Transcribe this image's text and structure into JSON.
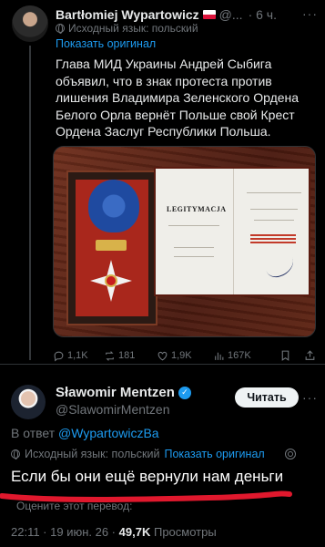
{
  "original_tweet": {
    "author_name": "Bartłomiej Wypartowicz",
    "handle": "@...",
    "time": "· 6 ч.",
    "source_language": "Исходный язык: польский",
    "show_original": "Показать оригинал",
    "text": "Глава МИД Украины Андрей Сыбига объявил, что в знак протеста против лишения Владимира Зеленского Ордена Белого Орла вернёт Польше свой Крест Ордена Заслуг Республики Польша.",
    "document_title": "LEGITYMACJA",
    "stats": {
      "replies": "1,1K",
      "reposts": "181",
      "likes": "1,9K",
      "views": "167K"
    }
  },
  "reply_tweet": {
    "author_name": "Sławomir Mentzen",
    "verified": true,
    "handle": "@SlawomirMentzen",
    "follow_button": "Читать",
    "in_reply_prefix": "В ответ",
    "in_reply_handle": "@WypartowiczBa",
    "source_language": "Исходный язык: польский",
    "show_original": "Показать оригинал",
    "text": "Если бы они ещё вернули нам деньги",
    "rate_translation": "Оцените этот перевод:",
    "timestamp": "22:11 · 19 июн. 26 ·",
    "views_count": "49,7K",
    "views_label": "Просмотры"
  },
  "colors": {
    "accent": "#1d9bf0",
    "background": "#000000",
    "highlight": "#e0182d"
  }
}
